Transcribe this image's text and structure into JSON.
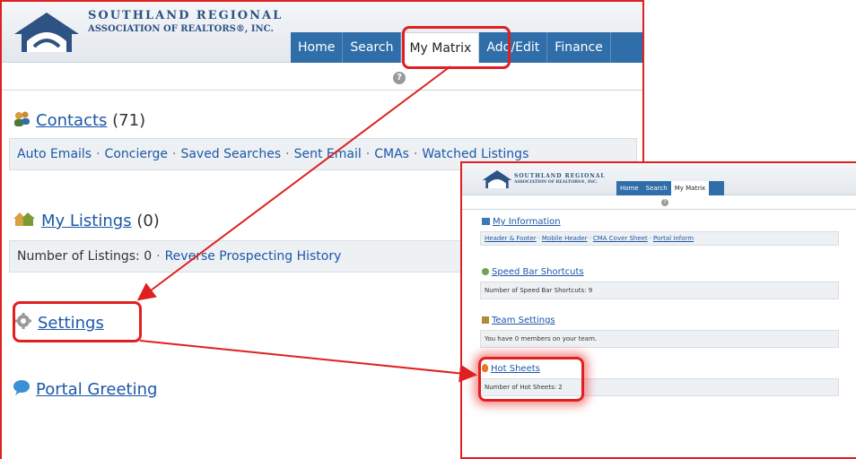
{
  "logo": {
    "line1": "SOUTHLAND REGIONAL",
    "line2": "ASSOCIATION OF REALTORS®, INC."
  },
  "nav": {
    "items": [
      "Home",
      "Search",
      "My Matrix",
      "Add/Edit",
      "Finance"
    ],
    "active": "My Matrix"
  },
  "help_glyph": "?",
  "contacts": {
    "label": "Contacts",
    "count": "(71)",
    "links": [
      "Auto Emails",
      "Concierge",
      "Saved Searches",
      "Sent Email",
      "CMAs",
      "Watched Listings"
    ]
  },
  "my_listings": {
    "label": "My Listings",
    "count": "(0)",
    "stat": "Number of Listings: 0",
    "link": "Reverse Prospecting History"
  },
  "settings": {
    "label": "Settings"
  },
  "portal_greeting": {
    "label": "Portal Greeting"
  },
  "separator": "·",
  "inset": {
    "logo": {
      "line1": "SOUTHLAND REGIONAL",
      "line2": "ASSOCIATION OF REALTORS®, INC."
    },
    "nav": [
      "Home",
      "Search",
      "My Matrix"
    ],
    "my_information": {
      "label": "My Information",
      "links": [
        "Header & Footer",
        "Mobile Header",
        "CMA Cover Sheet",
        "Portal Inform"
      ]
    },
    "speed_bar": {
      "label": "Speed Bar Shortcuts",
      "stat": "Number of Speed Bar Shortcuts: 9"
    },
    "team_settings": {
      "label": "Team Settings",
      "stat": "You have 0 members on your team."
    },
    "hot_sheets": {
      "label": "Hot Sheets",
      "stat": "Number of Hot Sheets: 2"
    }
  },
  "colors": {
    "nav_blue": "#2f6ea8",
    "link_blue": "#1c57a8",
    "highlight_red": "#e02020",
    "logo_blue": "#2d5283"
  },
  "icons": [
    "house-logo-icon",
    "help-icon",
    "contacts-icon",
    "my-listings-icon",
    "settings-gear-icon",
    "portal-greeting-bubble-icon",
    "my-information-icon",
    "speed-bar-icon",
    "team-settings-icon",
    "hot-sheets-flame-icon"
  ]
}
